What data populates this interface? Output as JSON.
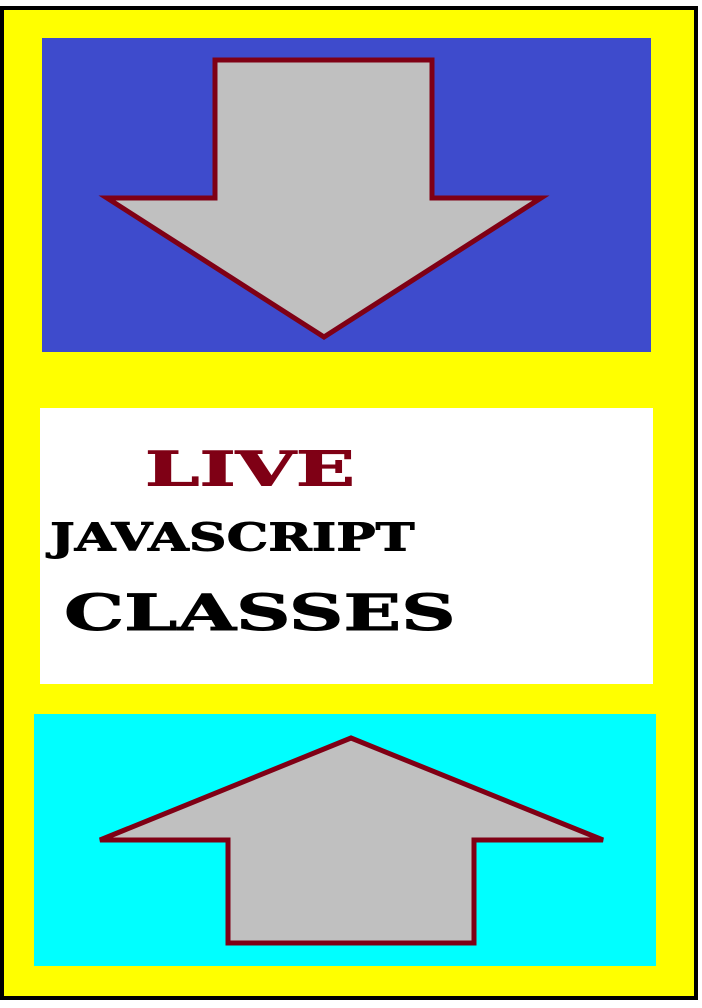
{
  "poster": {
    "title_line_1": "LIVE",
    "title_line_2": "JAVASCRIPT",
    "title_line_3": "CLASSES"
  },
  "colors": {
    "frame_border": "#000000",
    "background": "#ffff00",
    "top_panel": "#3e4bcc",
    "middle_panel": "#ffffff",
    "bottom_panel": "#00ffff",
    "arrow_fill": "#c0c0c0",
    "arrow_outline": "#7f0015",
    "title_accent": "#7f0015",
    "title_text": "#000000"
  },
  "icons": {
    "top": "arrow-down-icon",
    "bottom": "arrow-up-icon"
  }
}
